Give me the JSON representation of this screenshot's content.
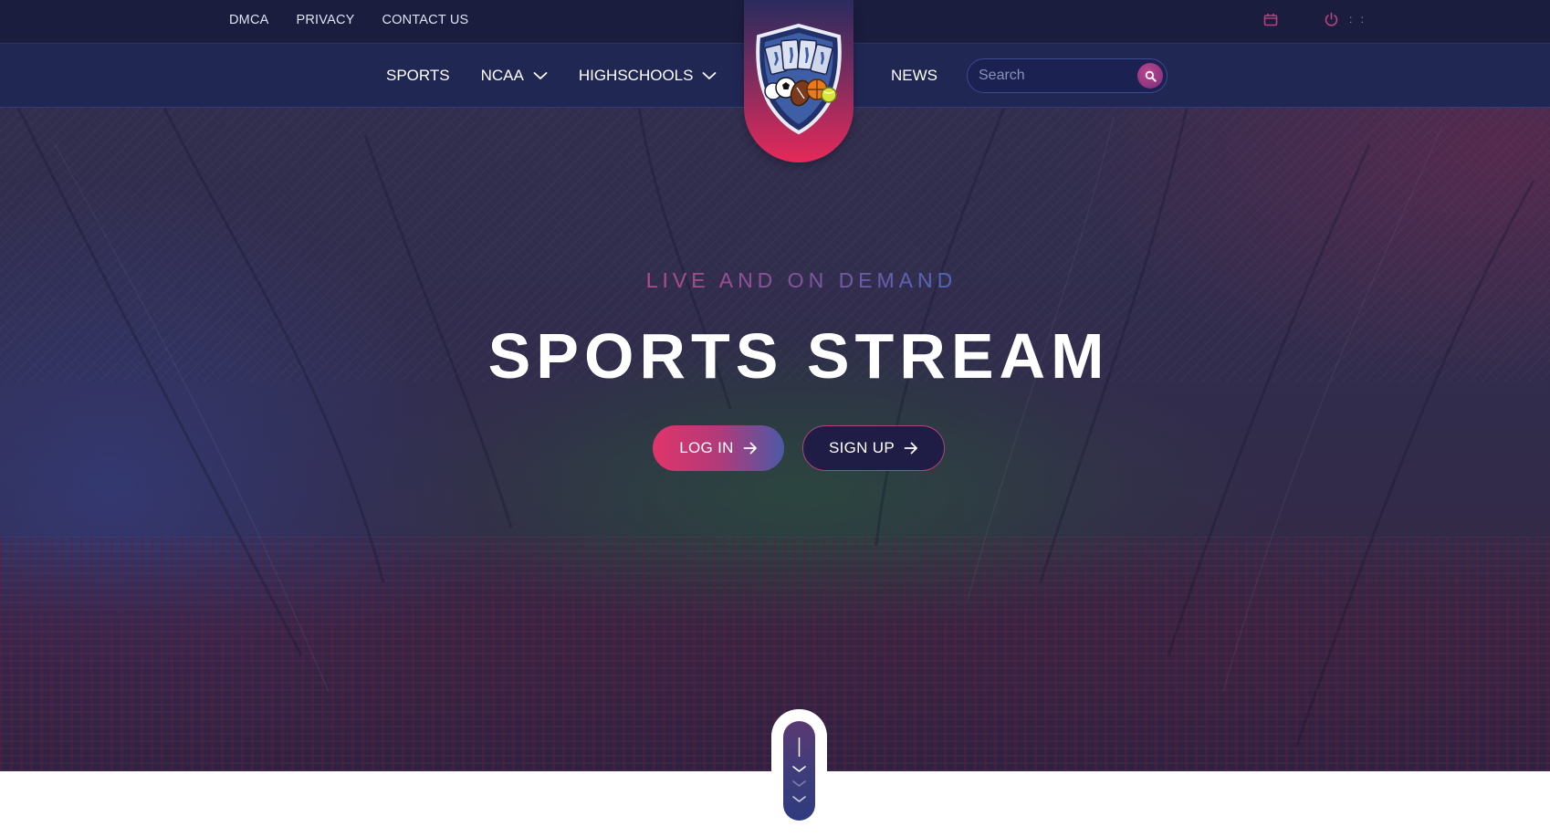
{
  "topbar": {
    "links": [
      {
        "label": "DMCA"
      },
      {
        "label": "PRIVACY"
      },
      {
        "label": "CONTACT US"
      }
    ],
    "icons": [
      "calendar-icon",
      "power-icon"
    ],
    "dots": ": :"
  },
  "nav": {
    "items": [
      {
        "label": "SPORTS",
        "dropdown": false
      },
      {
        "label": "NCAA",
        "dropdown": true
      },
      {
        "label": "HIGHSCHOOLS",
        "dropdown": true
      }
    ],
    "news_label": "NEWS",
    "search": {
      "placeholder": "Search",
      "value": ""
    }
  },
  "logo": {
    "icon": "sports-shield-logo"
  },
  "hero": {
    "subtitle": "LIVE AND ON DEMAND",
    "title": "SPORTS STREAM",
    "login_label": "LOG IN",
    "signup_label": "SIGN UP"
  },
  "colors": {
    "topbar_bg": "#1a1d3e",
    "nav_bg": "#202753",
    "accent_pink": "#e0356a",
    "accent_blue": "#4b5aa6"
  }
}
